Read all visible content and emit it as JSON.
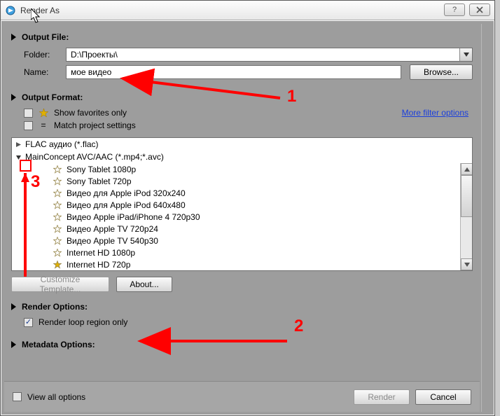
{
  "window": {
    "title": "Render As"
  },
  "sections": {
    "output_file": {
      "heading": "Output File:",
      "folder_label": "Folder:",
      "folder_value": "D:\\Проекты\\",
      "name_label": "Name:",
      "name_value": "мое видео",
      "browse_label": "Browse..."
    },
    "output_format": {
      "heading": "Output Format:",
      "show_favorites": "Show favorites only",
      "match_project": "Match project settings",
      "more_filter": "More filter options",
      "formats": {
        "flac": "FLAC аудио (*.flac)",
        "mainconcept": "MainConcept AVC/AAC (*.mp4;*.avc)"
      },
      "presets": [
        "Sony Tablet 1080p",
        "Sony Tablet 720p",
        "Видео для Apple iPod 320x240",
        "Видео для Apple iPod 640x480",
        "Видео Apple iPad/iPhone 4 720p30",
        "Видео Apple TV 720p24",
        "Видео Apple TV 540p30",
        "Internet HD 1080p",
        "Internet HD 720p"
      ],
      "customize_label": "Customize Template...",
      "about_label": "About..."
    },
    "render_options": {
      "heading": "Render Options:",
      "loop_region": "Render loop region only"
    },
    "metadata": {
      "heading": "Metadata Options:"
    }
  },
  "bottom": {
    "view_all": "View all options",
    "render": "Render",
    "cancel": "Cancel"
  },
  "annotations": {
    "a1": "1",
    "a2": "2",
    "a3": "3"
  }
}
